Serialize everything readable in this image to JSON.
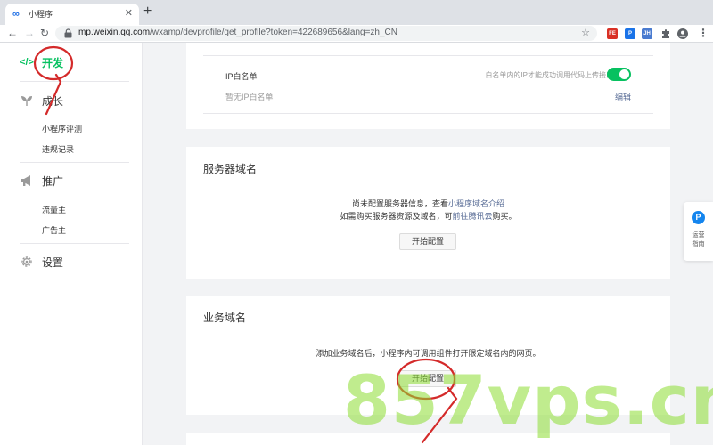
{
  "browser": {
    "tab_title": "小程序",
    "url_domain": "mp.weixin.qq.com",
    "url_path": "/wxamp/devprofile/get_profile?token=422689656&lang=zh_CN",
    "extensions": [
      {
        "name": "ext-fe",
        "label": "FE",
        "color": "#d93025"
      },
      {
        "name": "ext-p",
        "label": "P",
        "color": "#1a73e8"
      },
      {
        "name": "ext-jh",
        "label": "JH",
        "color": "#4a7bd0"
      }
    ]
  },
  "sidebar": {
    "develop": "开发",
    "growth": "成长",
    "growth_items": [
      "小程序评测",
      "违规记录"
    ],
    "promote": "推广",
    "promote_items": [
      "流量主",
      "广告主"
    ],
    "settings": "设置"
  },
  "ip_whitelist": {
    "label": "IP白名单",
    "hint": "白名单内的IP才能成功调用代码上传接口",
    "empty": "暂无IP白名单",
    "edit": "编辑",
    "enabled": true
  },
  "server_domain": {
    "title": "服务器域名",
    "line1_prefix": "尚未配置服务器信息，查看",
    "line1_link": "小程序域名介绍",
    "line2_prefix": "如需购买服务器资源及域名，可",
    "line2_link": "前往腾讯云",
    "line2_suffix": "购买。",
    "button": "开始配置"
  },
  "business_domain": {
    "title": "业务域名",
    "description": "添加业务域名后，小程序内可调用组件打开限定域名内的网页。",
    "button": "开始配置"
  },
  "help_float": {
    "badge": "P",
    "text": "运营指南"
  },
  "watermark": "857vps.cn",
  "colors": {
    "accent": "#07c160",
    "link": "#576b95",
    "annotation": "#d42a2a"
  }
}
